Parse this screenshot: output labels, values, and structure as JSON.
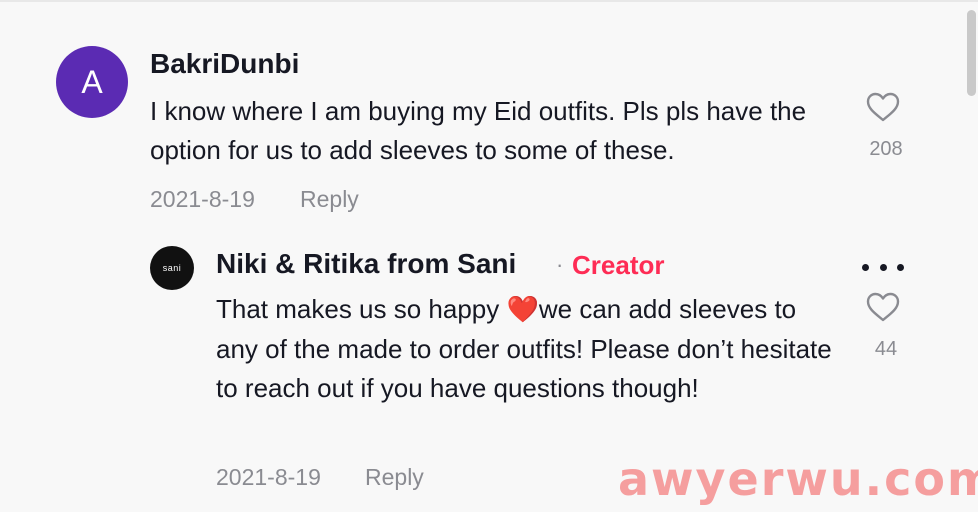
{
  "comment": {
    "avatar_letter": "A",
    "avatar_color": "#5b2bb3",
    "username": "BakriDunbi",
    "text": "I know where I am buying my Eid outfits. Pls pls have the option for us to add sleeves to some of these.",
    "date": "2021-8-19",
    "reply_label": "Reply",
    "like_icon": "heart-outline-icon",
    "like_count": "208"
  },
  "reply": {
    "avatar_text": "sani",
    "username": "Niki & Ritika from Sani",
    "separator": "·",
    "badge": "Creator",
    "badge_color": "#fe2c55",
    "more_icon": "more-horizontal-icon",
    "text_before_emoji": "That makes us so happy ",
    "emoji": "❤️",
    "text_after_emoji": "we can add sleeves to any of the made to order outfits! Please don’t hesitate to reach out if you have questions though!",
    "date": "2021-8-19",
    "reply_label": "Reply",
    "like_icon": "heart-outline-icon",
    "like_count": "44"
  },
  "watermark": "awyerwu.com"
}
